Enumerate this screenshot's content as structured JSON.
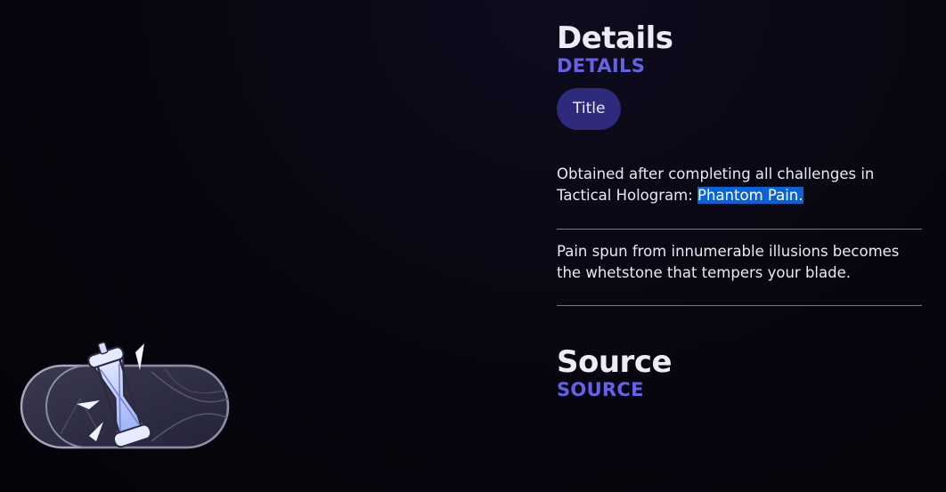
{
  "details": {
    "title": "Details",
    "subtitle": "DETAILS",
    "tag_label": "Title",
    "obtain_text_plain": "Obtained after completing all challenges in Tactical Hologram: ",
    "obtain_text_highlight": "Phantom Pain.",
    "flavor_text": "Pain spun from innumerable illusions becomes the whetstone that tempers your blade."
  },
  "source": {
    "title": "Source",
    "subtitle": "SOURCE"
  },
  "badge": {
    "icon": "hourglass-emblem-icon"
  },
  "colors": {
    "background": "#07060f",
    "subtitle_accent": "#6462ea",
    "pill_background": "#2f2b7c",
    "selection_highlight": "#0a63d6"
  }
}
